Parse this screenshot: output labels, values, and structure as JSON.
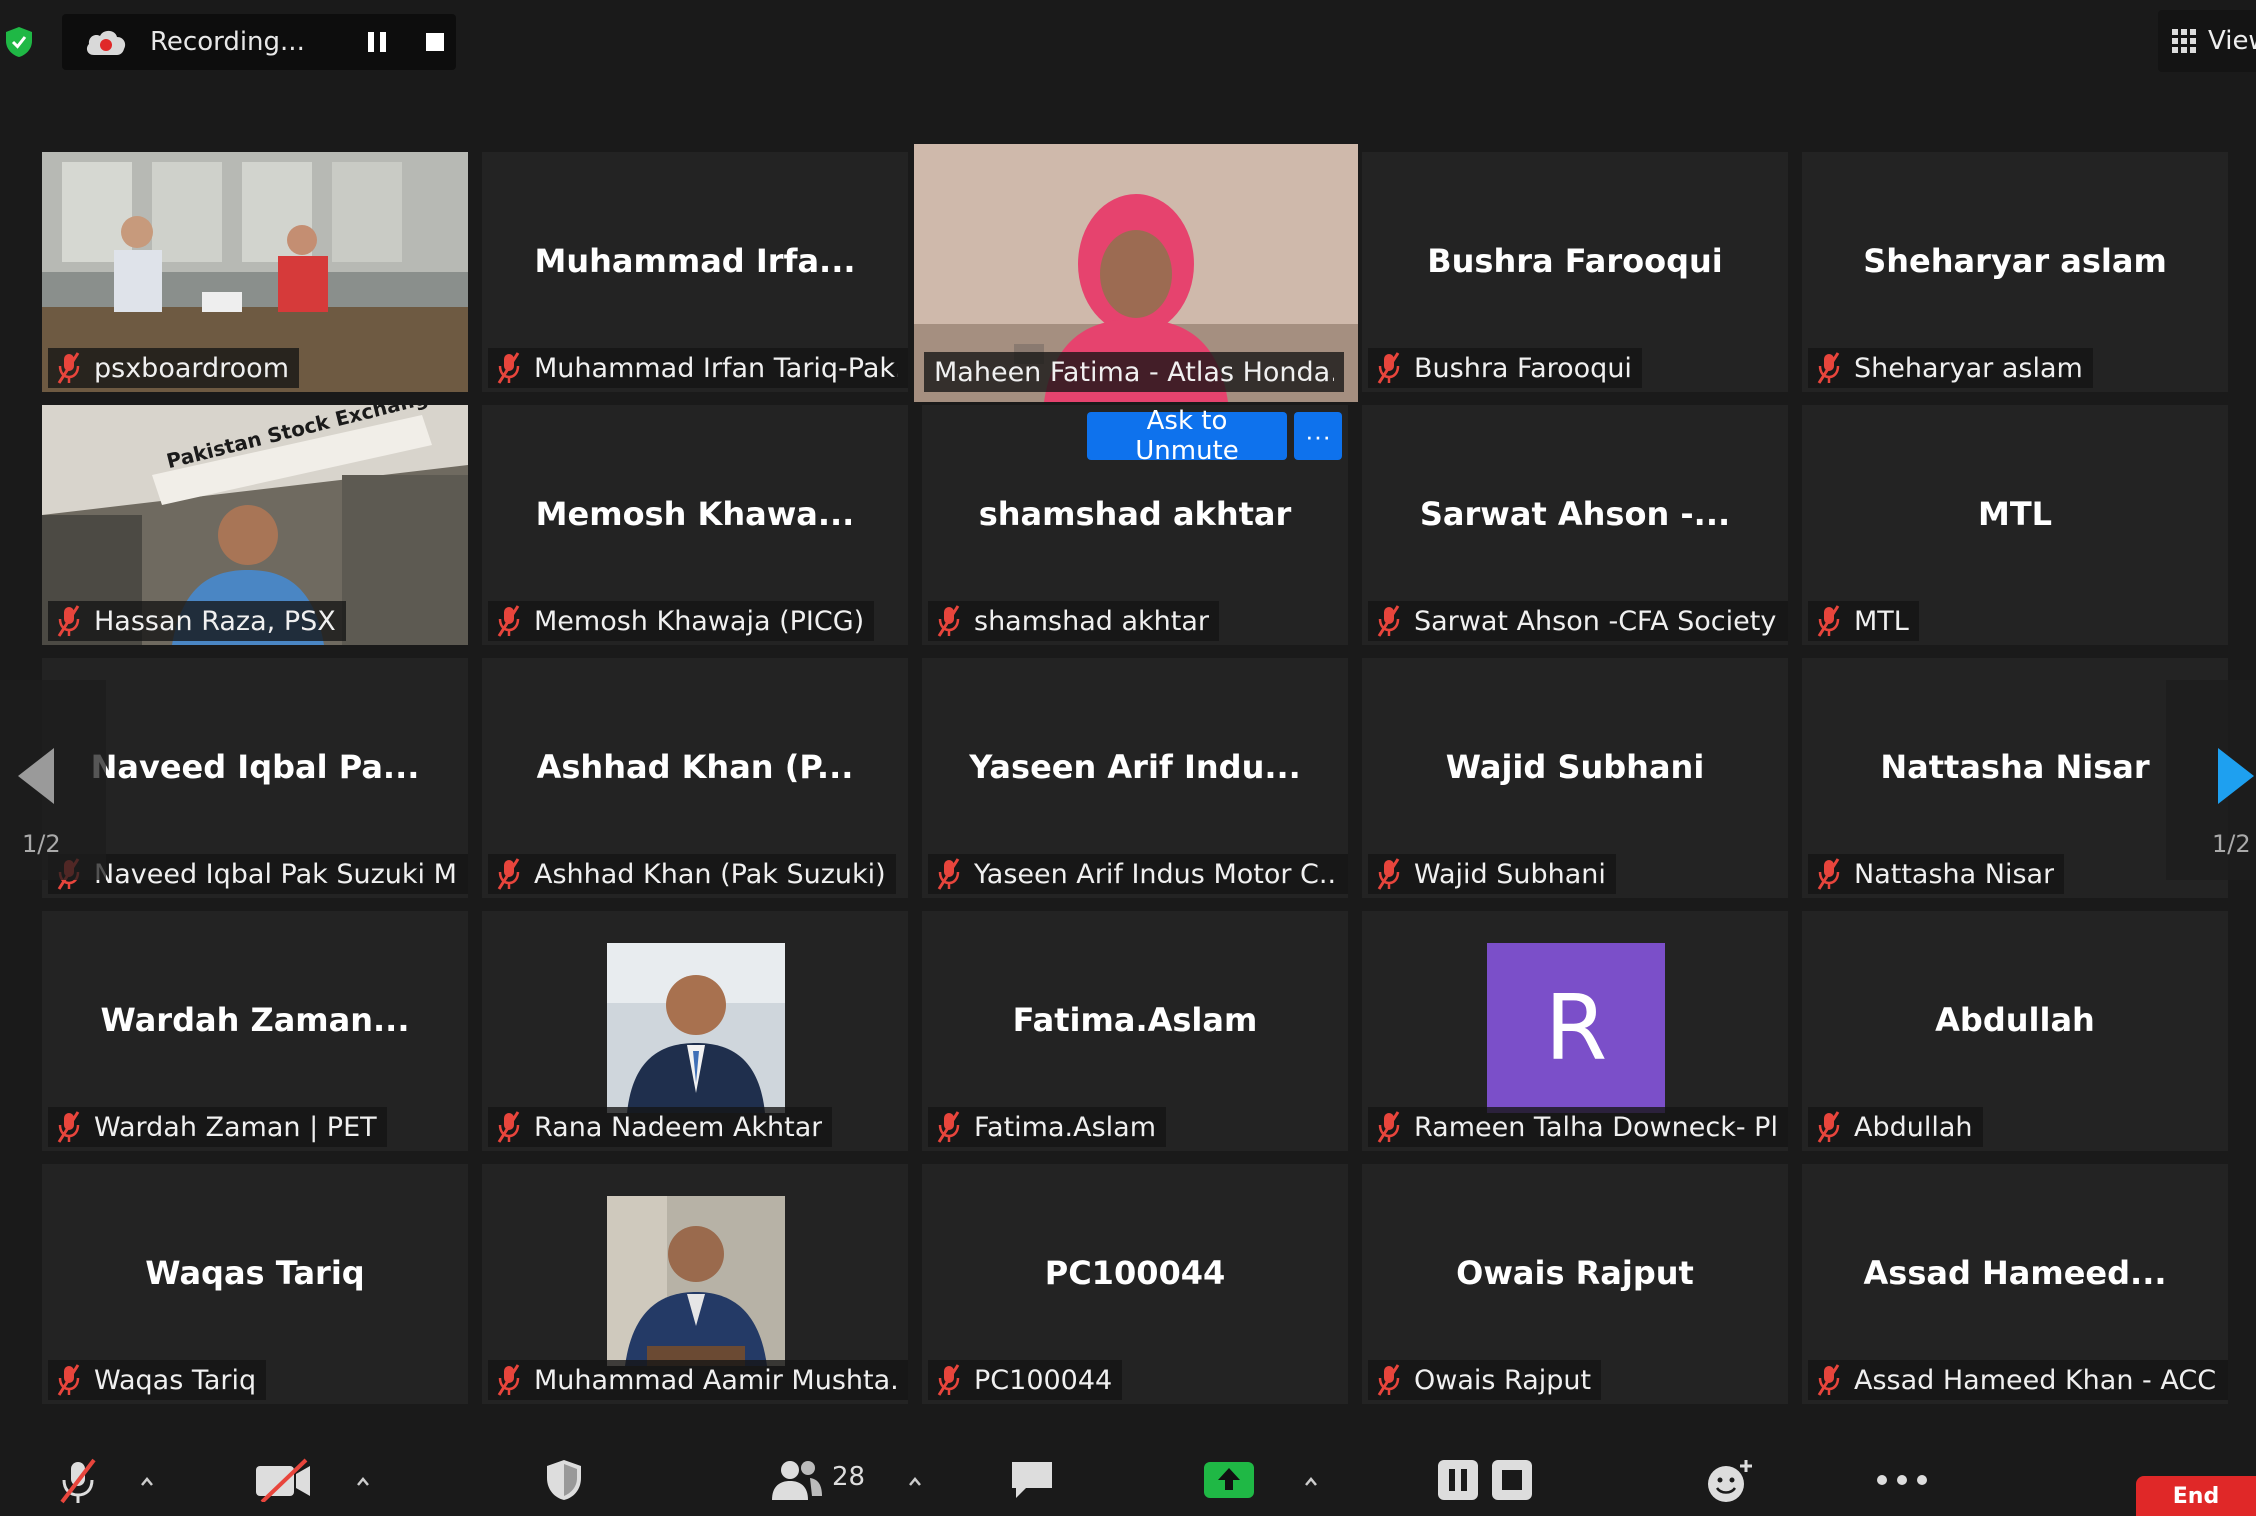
{
  "recording": {
    "label": "Recording..."
  },
  "view": {
    "label": "View"
  },
  "tiles": [
    {
      "big": "",
      "name": "psxboardroom"
    },
    {
      "big": "Muhammad  Irfa...",
      "name": "Muhammad Irfan Tariq-Pak..."
    },
    {
      "big": "",
      "name": "Maheen Fatima  - Atlas Honda..."
    },
    {
      "big": "Bushra Farooqui",
      "name": "Bushra Farooqui"
    },
    {
      "big": "Sheharyar aslam",
      "name": "Sheharyar aslam"
    },
    {
      "big": "",
      "name": "Hassan Raza, PSX"
    },
    {
      "big": "Memosh  Khawa...",
      "name": "Memosh Khawaja (PICG)"
    },
    {
      "big": "shamshad akhtar",
      "name": "shamshad akhtar"
    },
    {
      "big": "Sarwat Ahson  -...",
      "name": "Sarwat Ahson -CFA Society ..."
    },
    {
      "big": "MTL",
      "name": "MTL"
    },
    {
      "big": "Naveed  Iqbal  Pa...",
      "name": "Naveed Iqbal Pak Suzuki M..."
    },
    {
      "big": "Ashhad  Khan  (P...",
      "name": "Ashhad Khan (Pak Suzuki)"
    },
    {
      "big": "Yaseen  Arif  Indu...",
      "name": "Yaseen Arif Indus Motor C..."
    },
    {
      "big": "Wajid Subhani",
      "name": "Wajid Subhani"
    },
    {
      "big": "Nattasha Nisar",
      "name": "Nattasha Nisar"
    },
    {
      "big": "Wardah  Zaman...",
      "name": "Wardah Zaman | PET"
    },
    {
      "big": "",
      "name": "Rana Nadeem Akhtar"
    },
    {
      "big": "Fatima.Aslam",
      "name": "Fatima.Aslam"
    },
    {
      "big": "",
      "name": "Rameen Talha Downeck- Pl..."
    },
    {
      "big": "Abdullah",
      "name": "Abdullah"
    },
    {
      "big": "Waqas Tariq",
      "name": "Waqas Tariq"
    },
    {
      "big": "",
      "name": "Muhammad Aamir Mushta..."
    },
    {
      "big": "PC100044",
      "name": "PC100044"
    },
    {
      "big": "Owais Rajput",
      "name": "Owais Rajput"
    },
    {
      "big": "Assad  Hameed...",
      "name": "Assad Hameed Khan - ACC..."
    }
  ],
  "avatar_letter": "R",
  "sign_text": "Pakistan Stock Exchange",
  "ask_unmute": {
    "label": "Ask to Unmute",
    "more": "···"
  },
  "paging": {
    "left": "1/2",
    "right": "1/2"
  },
  "toolbar": {
    "participant_count": "28",
    "end_label": "End"
  },
  "colors": {
    "active_border": "#c6f23a",
    "button_blue": "#0e72ed",
    "mute_red": "#e8453c",
    "share_green": "#1fb845",
    "avatar_purple": "#7b4fc9"
  }
}
